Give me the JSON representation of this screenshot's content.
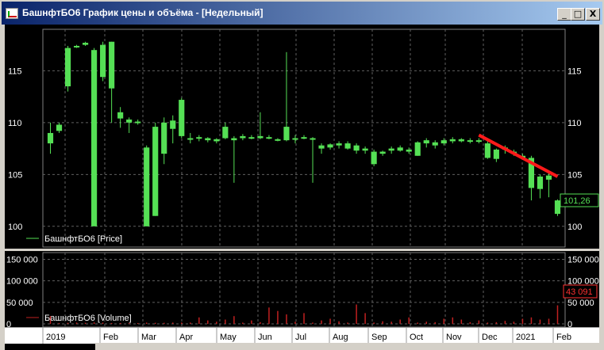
{
  "window": {
    "title": "БашнфтБО6 График цены и объёма - [Недельный]",
    "buttons": [
      "_",
      "□",
      "X"
    ]
  },
  "price_panel": {
    "legend": "БашнфтБО6 [Price]",
    "y_ticks": [
      "115",
      "110",
      "105",
      "100"
    ],
    "last_value": "101,26",
    "colors": {
      "candle": "#55e055",
      "trend": "#ff1a1a",
      "grid": "#606060",
      "value_box": "#55e055"
    }
  },
  "volume_panel": {
    "legend": "БашнфтБО6 [Volume]",
    "y_ticks": [
      "150 000",
      "100 000",
      "50 000",
      "0"
    ],
    "last_value": "43 091",
    "colors": {
      "bar": "#c02020",
      "value_box": "#ff3030"
    }
  },
  "time_axis": {
    "labels": [
      "2019",
      "Feb",
      "Mar",
      "Apr",
      "May",
      "Jun",
      "Jul",
      "Aug",
      "Sep",
      "Oct",
      "Nov",
      "Dec",
      "2021",
      "Feb"
    ]
  },
  "chart_data": [
    {
      "type": "candlestick",
      "ylim": [
        98,
        119
      ],
      "candles": [
        [
          109,
          108,
          110,
          107
        ],
        [
          109.2,
          109.8,
          110,
          109
        ],
        [
          113.5,
          117.2,
          117.4,
          113
        ],
        [
          117.4,
          117.4,
          117.5,
          117.2
        ],
        [
          117.5,
          117.7,
          117.8,
          117.4
        ],
        [
          100,
          117,
          117.2,
          100
        ],
        [
          114.4,
          117.5,
          117.8,
          114
        ],
        [
          113.3,
          117.8,
          117.8,
          110
        ],
        [
          110.4,
          111,
          111.5,
          109.5
        ],
        [
          110,
          110.3,
          110.5,
          109
        ],
        [
          110,
          110.1,
          110.3,
          109.8
        ],
        [
          100,
          107.6,
          107.8,
          100
        ],
        [
          101,
          109.6,
          110,
          101
        ],
        [
          107,
          110,
          110.5,
          106
        ],
        [
          109.4,
          110.2,
          110.7,
          108
        ],
        [
          108.7,
          112.2,
          112.4,
          108.5
        ],
        [
          108.4,
          108.5,
          109,
          108
        ],
        [
          108.5,
          108.6,
          108.8,
          108.2
        ],
        [
          108.3,
          108.5,
          108.6,
          108.1
        ],
        [
          108.2,
          108.4,
          108.5,
          108
        ],
        [
          108.5,
          109.6,
          110,
          108.4
        ],
        [
          108.3,
          108.5,
          108.7,
          104.2
        ],
        [
          108.5,
          108.7,
          108.9,
          108.3
        ],
        [
          108.5,
          108.6,
          108.8,
          108.4
        ],
        [
          108.5,
          108.7,
          111,
          108.4
        ],
        [
          108.5,
          108.6,
          108.8,
          108.4
        ],
        [
          108.3,
          108.4,
          108.5,
          108.2
        ],
        [
          108.3,
          109.6,
          116.8,
          108.2
        ],
        [
          108.4,
          108.5,
          108.8,
          108
        ],
        [
          108.5,
          108.6,
          108.8,
          108.4
        ],
        [
          108.4,
          108.5,
          108.6,
          104.2
        ],
        [
          107.5,
          107.8,
          108,
          107
        ],
        [
          107.6,
          107.9,
          108,
          107.4
        ],
        [
          107.8,
          108,
          108.2,
          107.5
        ],
        [
          107.5,
          108,
          108.2,
          107.4
        ],
        [
          107.3,
          107.8,
          108,
          107
        ],
        [
          107.3,
          107.5,
          107.7,
          107
        ],
        [
          106,
          107.2,
          107.4,
          105.8
        ],
        [
          107,
          107.2,
          107.3,
          106.8
        ],
        [
          107.3,
          107.5,
          107.7,
          107
        ],
        [
          107.3,
          107.6,
          107.8,
          107.2
        ],
        [
          107.2,
          107.4,
          107.6,
          107
        ],
        [
          106.8,
          108.1,
          108.2,
          106.8
        ],
        [
          108,
          108.3,
          108.5,
          107.6
        ],
        [
          107.8,
          108.1,
          108.3,
          107.5
        ],
        [
          108,
          108.3,
          108.5,
          107.8
        ],
        [
          108.2,
          108.4,
          108.6,
          108
        ],
        [
          108.2,
          108.4,
          108.5,
          108.1
        ],
        [
          108.2,
          108.3,
          108.5,
          108
        ],
        [
          108.2,
          108.3,
          108.5,
          108
        ],
        [
          106.6,
          108,
          108.2,
          106.5
        ],
        [
          106.5,
          107.4,
          107.5,
          106.2
        ],
        [
          107.4,
          107.6,
          107.8,
          107
        ],
        [
          107.1,
          107.2,
          107.4,
          106.8
        ],
        [
          106.6,
          106.8,
          107,
          106.5
        ],
        [
          103.7,
          106.6,
          106.8,
          102.5
        ],
        [
          103.6,
          104.8,
          105,
          102.7
        ],
        [
          104.5,
          104.9,
          105.1,
          102.8
        ],
        [
          101.2,
          102.5,
          102.6,
          101
        ]
      ],
      "trendline": {
        "from_candle": 49,
        "from_price": 108.8,
        "to_candle": 58,
        "to_price": 104.8
      }
    },
    {
      "type": "bar",
      "ylim": [
        0,
        160000
      ],
      "values": [
        18000,
        2000,
        2500,
        3000,
        2500,
        3500,
        3000,
        2000,
        2000,
        2000,
        2000,
        3000,
        2500,
        2500,
        3000,
        3000,
        3000,
        15000,
        8000,
        5000,
        10000,
        18000,
        3000,
        8000,
        4000,
        38000,
        30000,
        22000,
        5000,
        25000,
        3000,
        8000,
        12000,
        6000,
        3000,
        45000,
        25000,
        3000,
        6000,
        5000,
        10000,
        15000,
        3000,
        5000,
        4000,
        12000,
        15000,
        10000,
        4000,
        8000,
        3000,
        4000,
        7000,
        5000,
        12000,
        15000,
        10000,
        12000,
        43091
      ]
    }
  ]
}
